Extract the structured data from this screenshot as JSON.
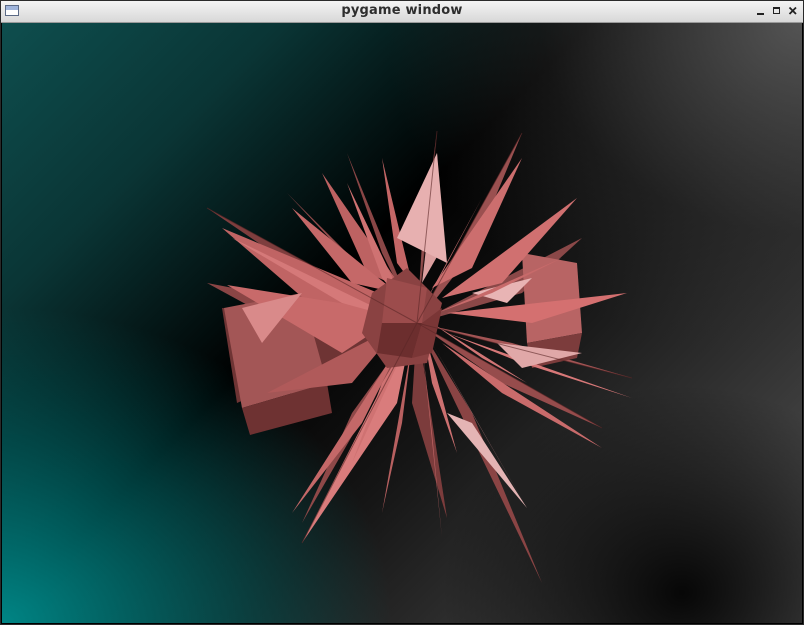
{
  "window": {
    "title": "pygame window",
    "icon": "app-window-icon",
    "controls": {
      "minimize": "minimize-icon",
      "maximize": "maximize-icon",
      "close": "close-icon"
    }
  },
  "scene": {
    "object": "stellated-polyhedron",
    "object_color": "#c86a6a",
    "background_colors": {
      "bottom_left": "#008080",
      "center": "#000000",
      "top_right": "#5a5a5a"
    }
  }
}
